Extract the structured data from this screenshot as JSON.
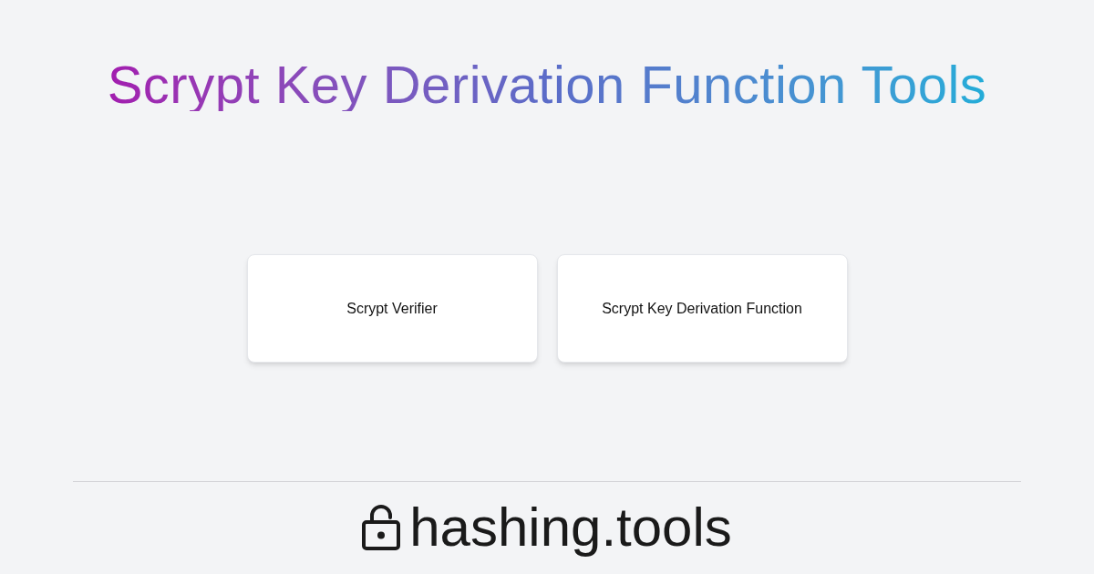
{
  "title": "Scrypt Key Derivation Function Tools",
  "tools": [
    {
      "label": "Scrypt Verifier"
    },
    {
      "label": "Scrypt Key Derivation Function"
    }
  ],
  "footer": {
    "brand": "hashing.tools"
  }
}
